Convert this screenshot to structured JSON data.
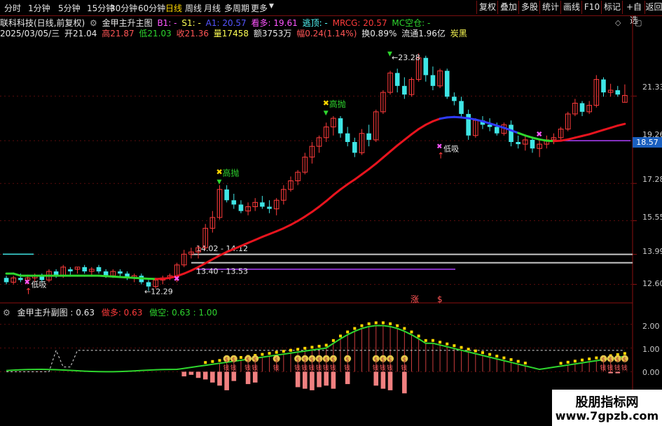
{
  "toolbar": {
    "periods": [
      "分时",
      "1分钟",
      "5分钟",
      "15分钟",
      "30分钟",
      "60分钟",
      "日线",
      "周线",
      "月线",
      "多周期",
      "更多"
    ],
    "active_period": "日线",
    "right_buttons": [
      "复权",
      "叠加",
      "多股",
      "统计",
      "画线",
      "F10",
      "标记",
      "+自选",
      "返回"
    ]
  },
  "info": {
    "stock": "联科科技(日线,前复权)",
    "indicator_name": "金甲主升主图",
    "b1": "B1: -",
    "s1": "S1: -",
    "a1": "A1: 20.57",
    "look_long": "看多: 19.61",
    "escape_top": "逃顶: -",
    "mrcg": "MRCG: 20.57",
    "mc": "MC空仓: -",
    "date": "2025/03/05/三",
    "open": "开21.04",
    "high": "高21.87",
    "low": "低21.03",
    "close": "收21.36",
    "volume": "量17458",
    "amount": "额3753万",
    "change": "幅0.24(1.14%)",
    "turnover": "换0.89%",
    "float": "流通1.96亿",
    "concept": "炭黑"
  },
  "axis": {
    "price_labels": [
      "21.33",
      "19.26",
      "17.28",
      "15.55",
      "13.99",
      "12.60"
    ],
    "current_price": "18.57",
    "sub_labels": [
      "2.00",
      "1.00",
      "0.00"
    ]
  },
  "indicator": {
    "title": "金甲主升副图 : 0.63",
    "long": "做多: 0.63",
    "short": "做空: 0.63 : 1.00"
  },
  "annotations": {
    "high_sell": "高抛",
    "low_buy": "低吸",
    "peak": "23.28",
    "low_price": "12.29",
    "range_a": "14.02 - 14.12",
    "range_b": "13.40 - 13.53",
    "zhang": "涨",
    "money": "$",
    "bag_char": "$",
    "bag_label": "钱"
  },
  "watermark": {
    "line1": "股朋指标网",
    "line2": "www.7gpzb.com"
  },
  "colors": {
    "up": "#ff3b3b",
    "down": "#3fe6e6",
    "ma": "#e8141e",
    "green_line": "#2ed62e",
    "blue_line": "#2f3cff",
    "yellow": "#ffd700"
  },
  "chart_data": {
    "type": "candlestick",
    "ylim": [
      12.0,
      24.0
    ],
    "candles": [
      [
        12.9,
        13.0,
        12.6,
        12.7
      ],
      [
        12.7,
        13.0,
        12.6,
        12.9
      ],
      [
        12.9,
        13.1,
        12.7,
        12.8
      ],
      [
        12.8,
        13.0,
        12.6,
        12.9
      ],
      [
        12.9,
        13.1,
        12.7,
        13.0
      ],
      [
        13.0,
        13.1,
        12.7,
        12.8
      ],
      [
        12.8,
        13.3,
        12.7,
        13.2
      ],
      [
        13.2,
        13.3,
        12.9,
        13.0
      ],
      [
        13.0,
        13.5,
        12.9,
        13.4
      ],
      [
        13.3,
        13.4,
        13.0,
        13.2
      ],
      [
        13.3,
        13.4,
        13.1,
        13.4
      ],
      [
        13.4,
        13.5,
        13.1,
        13.2
      ],
      [
        13.2,
        13.4,
        13.0,
        13.3
      ],
      [
        13.4,
        13.5,
        13.1,
        13.2
      ],
      [
        13.2,
        13.3,
        12.9,
        13.0
      ],
      [
        13.0,
        13.3,
        12.9,
        13.2
      ],
      [
        13.2,
        13.3,
        12.9,
        13.1
      ],
      [
        13.1,
        13.2,
        12.8,
        12.9
      ],
      [
        12.9,
        13.1,
        12.7,
        13.0
      ],
      [
        13.0,
        13.1,
        12.6,
        12.7
      ],
      [
        12.7,
        12.8,
        12.3,
        12.5
      ],
      [
        12.5,
        12.9,
        12.4,
        12.8
      ],
      [
        12.8,
        13.0,
        12.6,
        12.9
      ],
      [
        12.9,
        13.1,
        12.8,
        13.0
      ],
      [
        13.0,
        13.6,
        12.7,
        13.5
      ],
      [
        13.5,
        14.2,
        13.4,
        14.0
      ],
      [
        14.0,
        14.3,
        13.8,
        14.1
      ],
      [
        14.1,
        14.4,
        13.8,
        14.3
      ],
      [
        14.3,
        15.4,
        14.2,
        15.2
      ],
      [
        15.2,
        16.0,
        15.0,
        15.7
      ],
      [
        15.7,
        17.2,
        15.6,
        17.0
      ],
      [
        17.0,
        17.2,
        16.4,
        16.5
      ],
      [
        16.5,
        16.8,
        16.1,
        16.3
      ],
      [
        16.3,
        16.5,
        15.9,
        16.0
      ],
      [
        16.0,
        16.4,
        15.8,
        16.2
      ],
      [
        16.2,
        16.6,
        16.0,
        16.4
      ],
      [
        16.4,
        16.7,
        16.1,
        16.2
      ],
      [
        16.2,
        16.5,
        15.9,
        16.1
      ],
      [
        16.1,
        16.6,
        15.8,
        16.5
      ],
      [
        16.5,
        17.2,
        16.3,
        17.0
      ],
      [
        17.0,
        17.6,
        16.9,
        17.4
      ],
      [
        17.4,
        17.9,
        17.2,
        17.8
      ],
      [
        17.8,
        18.7,
        17.7,
        18.5
      ],
      [
        18.5,
        19.2,
        18.2,
        19.0
      ],
      [
        19.0,
        19.5,
        18.7,
        19.4
      ],
      [
        19.4,
        20.1,
        19.2,
        19.9
      ],
      [
        19.9,
        20.4,
        19.5,
        20.3
      ],
      [
        20.3,
        20.4,
        19.4,
        19.6
      ],
      [
        19.6,
        19.9,
        19.0,
        19.2
      ],
      [
        19.2,
        19.4,
        18.5,
        18.7
      ],
      [
        18.7,
        19.8,
        18.6,
        19.6
      ],
      [
        19.6,
        20.0,
        19.0,
        19.3
      ],
      [
        19.3,
        20.7,
        19.2,
        20.6
      ],
      [
        20.6,
        21.6,
        20.5,
        21.5
      ],
      [
        21.5,
        22.5,
        21.4,
        22.4
      ],
      [
        22.4,
        22.6,
        21.5,
        21.8
      ],
      [
        21.8,
        22.2,
        21.2,
        21.4
      ],
      [
        21.4,
        22.2,
        21.3,
        22.1
      ],
      [
        22.1,
        23.3,
        22.0,
        23.1
      ],
      [
        23.1,
        23.2,
        22.0,
        22.3
      ],
      [
        22.3,
        22.7,
        21.6,
        21.8
      ],
      [
        21.8,
        22.6,
        21.7,
        22.5
      ],
      [
        22.5,
        22.6,
        21.2,
        21.3
      ],
      [
        21.3,
        21.5,
        20.9,
        21.1
      ],
      [
        21.1,
        21.3,
        20.3,
        20.5
      ],
      [
        20.5,
        20.7,
        19.3,
        19.5
      ],
      [
        19.5,
        20.3,
        19.4,
        20.2
      ],
      [
        20.2,
        20.4,
        19.8,
        20.0
      ],
      [
        20.0,
        20.3,
        19.7,
        19.9
      ],
      [
        19.9,
        20.1,
        19.5,
        19.6
      ],
      [
        19.6,
        20.1,
        19.5,
        20.0
      ],
      [
        20.0,
        20.2,
        19.0,
        19.2
      ],
      [
        19.2,
        19.5,
        18.9,
        19.1
      ],
      [
        19.1,
        19.5,
        18.8,
        19.3
      ],
      [
        19.3,
        19.4,
        18.7,
        18.9
      ],
      [
        18.9,
        19.3,
        18.5,
        19.1
      ],
      [
        19.1,
        19.5,
        18.9,
        19.3
      ],
      [
        19.3,
        19.6,
        19.1,
        19.4
      ],
      [
        19.4,
        19.9,
        19.3,
        19.8
      ],
      [
        19.8,
        20.6,
        19.7,
        20.5
      ],
      [
        20.5,
        21.2,
        20.4,
        21.0
      ],
      [
        21.0,
        21.1,
        20.4,
        20.6
      ],
      [
        20.6,
        21.1,
        20.5,
        20.9
      ],
      [
        20.9,
        22.3,
        20.8,
        22.1
      ],
      [
        22.1,
        22.2,
        21.3,
        21.5
      ],
      [
        21.5,
        21.9,
        21.3,
        21.6
      ],
      [
        21.6,
        21.8,
        21.3,
        21.4
      ],
      [
        21.04,
        21.87,
        21.03,
        21.36
      ]
    ],
    "ma": [
      13.1,
      13.1,
      13.0,
      13.0,
      13.0,
      13.0,
      13.0,
      13.0,
      13.0,
      13.0,
      13.0,
      13.0,
      13.0,
      13.0,
      12.98,
      12.96,
      12.94,
      12.92,
      12.9,
      12.88,
      12.86,
      12.85,
      12.86,
      12.9,
      12.98,
      13.1,
      13.24,
      13.4,
      13.58,
      13.76,
      13.94,
      14.1,
      14.24,
      14.38,
      14.52,
      14.66,
      14.8,
      14.93,
      15.06,
      15.2,
      15.36,
      15.54,
      15.74,
      15.96,
      16.2,
      16.46,
      16.74,
      17.0,
      17.24,
      17.46,
      17.7,
      17.94,
      18.2,
      18.48,
      18.76,
      19.04,
      19.3,
      19.56,
      19.8,
      20.0,
      20.16,
      20.28,
      20.34,
      20.36,
      20.34,
      20.3,
      20.24,
      20.16,
      20.06,
      19.96,
      19.86,
      19.74,
      19.62,
      19.5,
      19.4,
      19.32,
      19.26,
      19.24,
      19.26,
      19.32,
      19.4,
      19.48,
      19.56,
      19.66,
      19.76,
      19.86,
      19.96,
      20.04
    ],
    "escape_levels": [
      14.07,
      13.47
    ],
    "support_levels": [
      13.99,
      13.6
    ]
  }
}
